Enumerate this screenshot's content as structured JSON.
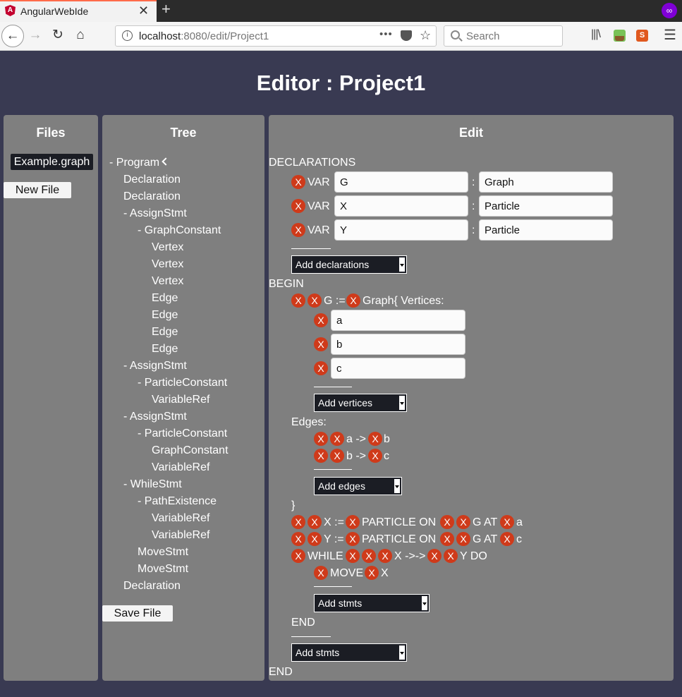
{
  "browser": {
    "tab_title": "AngularWebIde",
    "tab_close": "✕",
    "new_tab": "+",
    "url_host": "localhost",
    "url_path": ":8080/edit/Project1",
    "url_more": "•••",
    "search_placeholder": "Search"
  },
  "page_title": "Editor : Project1",
  "files": {
    "title": "Files",
    "items": [
      "Example.graph"
    ],
    "new_file_label": "New File"
  },
  "tree": {
    "title": "Tree",
    "save_label": "Save File",
    "nodes": [
      "- Program",
      "Declaration",
      "Declaration",
      "- AssignStmt",
      "- GraphConstant",
      "Vertex",
      "Vertex",
      "Vertex",
      "Edge",
      "Edge",
      "Edge",
      "Edge",
      "- AssignStmt",
      "- ParticleConstant",
      "VariableRef",
      "- AssignStmt",
      "- ParticleConstant",
      "GraphConstant",
      "VariableRef",
      "- WhileStmt",
      "- PathExistence",
      "VariableRef",
      "VariableRef",
      "MoveStmt",
      "MoveStmt",
      "Declaration"
    ]
  },
  "edit": {
    "title": "Edit",
    "x": "X",
    "declarations_kw": "DECLARATIONS",
    "var_kw": "VAR",
    "colon": ":",
    "declarations": [
      {
        "name": "G",
        "type": "Graph"
      },
      {
        "name": "X",
        "type": "Particle"
      },
      {
        "name": "Y",
        "type": "Particle"
      }
    ],
    "add_declarations": "Add declarations",
    "begin_kw": "BEGIN",
    "g_assign": "G :=",
    "graph_vertices": "Graph{ Vertices:",
    "vertices": [
      "a",
      "b",
      "c"
    ],
    "add_vertices": "Add vertices",
    "edges_label": "Edges:",
    "edges": [
      {
        "from": "a ->",
        "to": "b"
      },
      {
        "from": "b ->",
        "to": "c"
      }
    ],
    "add_edges": "Add edges",
    "close_brace": "}",
    "stmt_x_assign": "X :=",
    "stmt_y_assign": "Y :=",
    "particle_on": "PARTICLE ON",
    "g_at": "G AT",
    "x_at_val": "a",
    "y_at_val": "c",
    "while_kw": "WHILE",
    "path_x": "X ->->",
    "y_do": "Y DO",
    "move_kw": "MOVE",
    "move_target": "X",
    "add_stmts": "Add stmts",
    "end_kw": "END"
  }
}
